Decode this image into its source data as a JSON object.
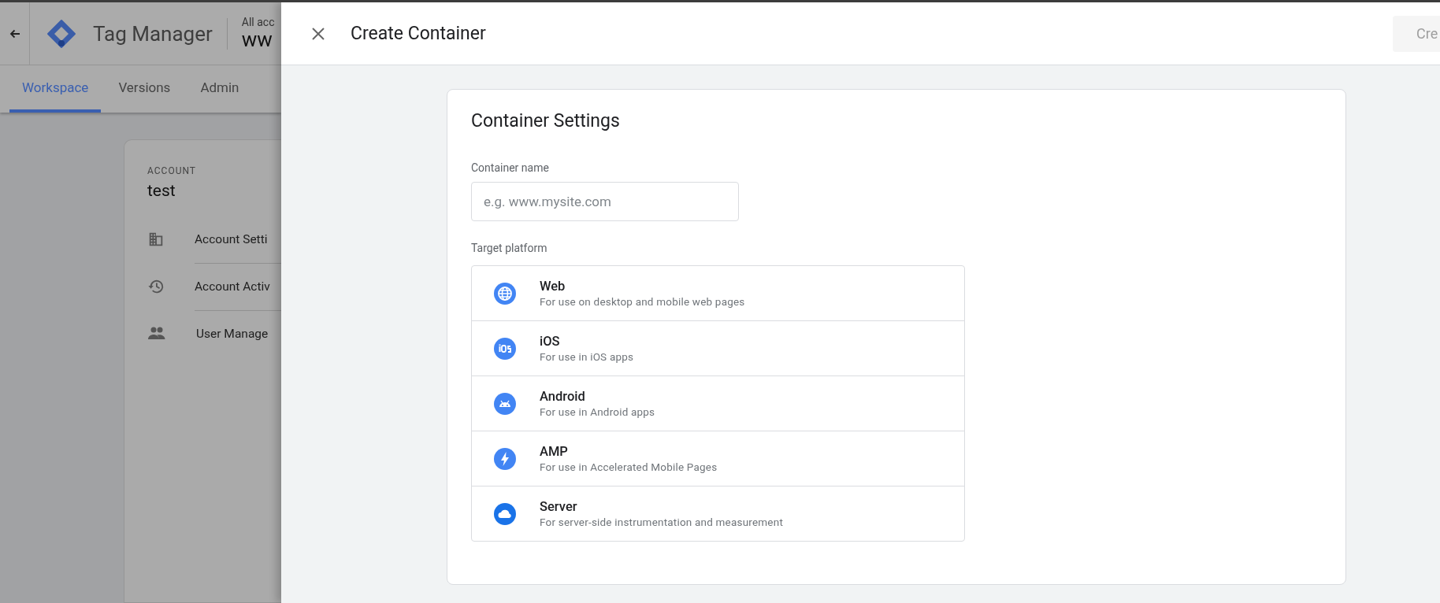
{
  "background": {
    "app_title": "Tag Manager",
    "account_caption": "All acc",
    "container_name": "ww",
    "tabs": [
      {
        "label": "Workspace",
        "selected": true
      },
      {
        "label": "Versions",
        "selected": false
      },
      {
        "label": "Admin",
        "selected": false
      }
    ],
    "account_card": {
      "caption": "ACCOUNT",
      "name": "test",
      "items": [
        "Account Setti",
        "Account Activ",
        "User Manage"
      ]
    }
  },
  "panel": {
    "title": "Create Container",
    "create_button": {
      "label": "Cre",
      "disabled": true
    },
    "settings": {
      "title": "Container Settings",
      "name_label": "Container name",
      "name_placeholder": "e.g. www.mysite.com",
      "platform_label": "Target platform",
      "platforms": [
        {
          "name": "Web",
          "description": "For use on desktop and mobile web pages"
        },
        {
          "name": "iOS",
          "description": "For use in iOS apps"
        },
        {
          "name": "Android",
          "description": "For use in Android apps"
        },
        {
          "name": "AMP",
          "description": "For use in Accelerated Mobile Pages"
        },
        {
          "name": "Server",
          "description": "For server-side instrumentation and measurement"
        }
      ]
    }
  }
}
